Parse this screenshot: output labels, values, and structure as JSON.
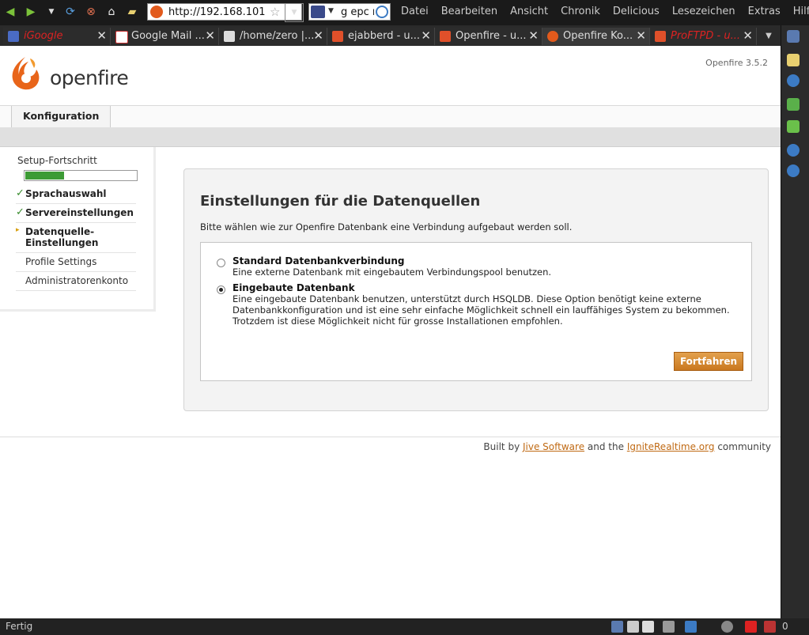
{
  "browser": {
    "url": "http://192.168.101",
    "search_text": "g epc r",
    "menu": [
      "Datei",
      "Bearbeiten",
      "Ansicht",
      "Chronik",
      "Delicious",
      "Lesezeichen",
      "Extras",
      "Hilfe"
    ],
    "tabs": [
      {
        "label": "iGoogle",
        "red": true
      },
      {
        "label": "Google Mail ...",
        "red": false
      },
      {
        "label": "/home/zero |...",
        "red": false
      },
      {
        "label": "ejabberd - u...",
        "red": false
      },
      {
        "label": "Openfire - u...",
        "red": false
      },
      {
        "label": "Openfire Ko...",
        "red": false,
        "active": true
      },
      {
        "label": "ProFTPD - u...",
        "red": true
      }
    ],
    "status": "Fertig",
    "status_count": "0"
  },
  "header": {
    "logo_text": "openfire",
    "version": "Openfire 3.5.2",
    "nav_tab": "Konfiguration"
  },
  "setup": {
    "title": "Setup-Fortschritt",
    "progress_fraction": 0.35,
    "steps": [
      {
        "label": "Sprachauswahl",
        "state": "done"
      },
      {
        "label": "Servereinstellungen",
        "state": "done"
      },
      {
        "label": "Datenquelle-Einstellungen",
        "state": "current"
      },
      {
        "label": "Profile Settings",
        "state": "todo"
      },
      {
        "label": "Administratorenkonto",
        "state": "todo"
      }
    ]
  },
  "main": {
    "title": "Einstellungen für die Datenquellen",
    "description": "Bitte wählen wie zur Openfire Datenbank eine Verbindung aufgebaut werden soll.",
    "options": [
      {
        "title": "Standard Datenbankverbindung",
        "desc": "Eine externe Datenbank mit eingebautem Verbindungspool benutzen.",
        "selected": false
      },
      {
        "title": "Eingebaute Datenbank",
        "desc_lines": [
          "Eine eingebaute Datenbank benutzen, unterstützt durch HSQLDB. Diese Option benötigt keine externe",
          "Datenbankkonfiguration und ist eine sehr einfache Möglichkeit schnell ein lauffähiges System zu bekommen.",
          "Trotzdem ist diese Möglichkeit nicht für grosse Installationen empfohlen."
        ],
        "selected": true
      }
    ],
    "continue_label": "Fortfahren"
  },
  "footer": {
    "prefix": "Built by",
    "link1": "Jive Software",
    "middle": "and the",
    "link2": "IgniteRealtime.org",
    "suffix": "community"
  },
  "colors": {
    "accent": "#c9781f",
    "progress": "#3d9b35",
    "link": "#c06a14"
  }
}
